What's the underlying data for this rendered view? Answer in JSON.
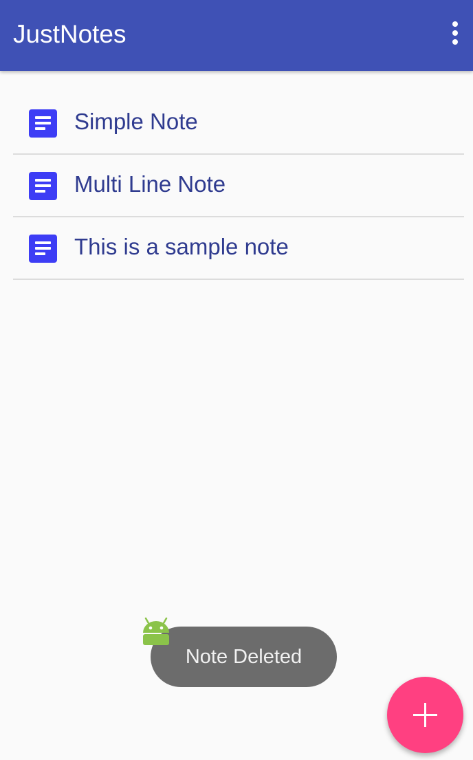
{
  "app_bar": {
    "title": "JustNotes",
    "background_color": "#3f51b5",
    "menu_icon": "more-vert-icon"
  },
  "notes": [
    {
      "title": "Simple Note",
      "icon": "note-document-icon"
    },
    {
      "title": "Multi Line Note",
      "icon": "note-document-icon"
    },
    {
      "title": "This is a sample note",
      "icon": "note-document-icon"
    }
  ],
  "toast": {
    "message": "Note Deleted",
    "icon": "android-icon"
  },
  "fab": {
    "icon": "plus-icon",
    "color": "#ff4081"
  },
  "colors": {
    "note_icon": "#3d3df5",
    "note_text": "#2f3b8f",
    "background": "#fafafa"
  }
}
